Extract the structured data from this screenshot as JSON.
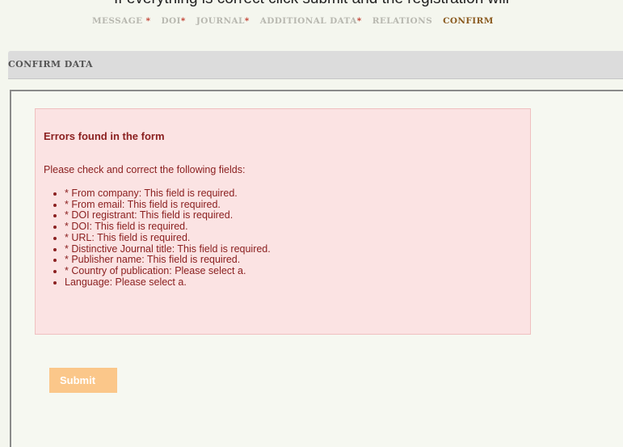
{
  "caption": "If everything is correct click submit and the registration will",
  "wizard": {
    "steps": [
      {
        "label": "MESSAGE",
        "required": " *",
        "active": false
      },
      {
        "label": "DOI",
        "required": "*",
        "active": false
      },
      {
        "label": "JOURNAL",
        "required": "*",
        "active": false
      },
      {
        "label": "ADDITIONAL DATA",
        "required": "*",
        "active": false
      },
      {
        "label": "RELATIONS",
        "required": "",
        "active": false
      },
      {
        "label": "CONFIRM",
        "required": "",
        "active": true
      }
    ]
  },
  "section": {
    "title": "CONFIRM DATA"
  },
  "errors": {
    "title": "Errors found in the form",
    "intro": "Please check and correct the following fields:",
    "items": [
      "* From company: This field is required.",
      "* From email: This field is required.",
      "* DOI registrant: This field is required.",
      "* DOI: This field is required.",
      "* URL: This field is required.",
      "* Distinctive Journal title: This field is required.",
      "* Publisher name: This field is required.",
      "* Country of publication: Please select a.",
      "Language: Please select a."
    ]
  },
  "form": {
    "submit_label": "Submit"
  },
  "colors": {
    "active_step": "#8a5a1f",
    "required_marker": "#c0392b",
    "error_bg": "#fbe3e3",
    "error_text": "#8b2020",
    "submit_bg": "#fbc78a"
  }
}
